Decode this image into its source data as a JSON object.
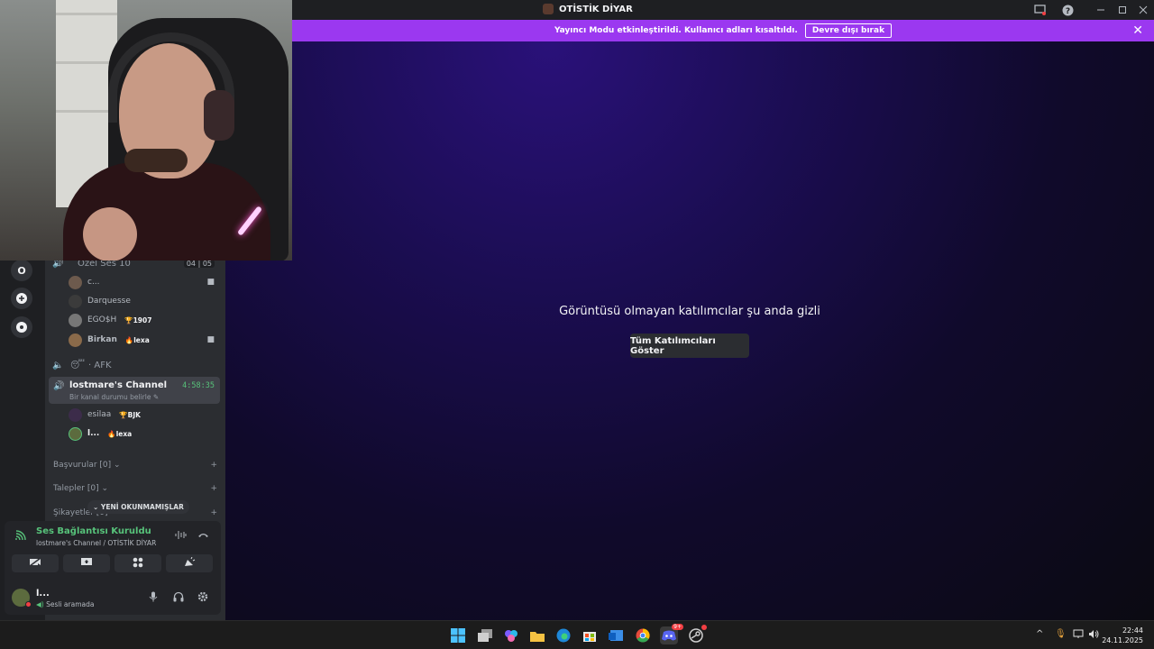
{
  "window": {
    "title": "OTİSTİK DİYAR"
  },
  "banner": {
    "message": "Yayıncı Modu etkinleştirildi. Kullanıcı adları kısaltıldı.",
    "disable_label": "Devre dışı bırak"
  },
  "stage": {
    "hidden_message": "Görüntüsü olmayan katılımcılar şu anda gizli",
    "show_all_label": "Tüm Katılımcıları Göster"
  },
  "rail": {
    "server_initial": "O"
  },
  "channels": {
    "private_channel": {
      "name": "Özel Ses 10",
      "count_a": "04",
      "count_b": "05",
      "users": [
        {
          "name": "c...",
          "badge": ""
        },
        {
          "name": "Darquesse",
          "badge": ""
        },
        {
          "name": "EGO$H",
          "badge": "1907"
        },
        {
          "name": "Birkan",
          "badge": "lexa"
        }
      ]
    },
    "afk": {
      "name": "AFK"
    },
    "active": {
      "name": "lostmare's Channel",
      "status": "Bir kanal durumu belirle",
      "timer": "4:58:35",
      "users": [
        {
          "name": "esilaa",
          "badge": "BJK"
        },
        {
          "name": "l...",
          "badge": "lexa"
        }
      ]
    },
    "categories": [
      {
        "name": "Başvurular [0]"
      },
      {
        "name": "Talepler [0]"
      },
      {
        "name": "Şikayetler [0]"
      }
    ],
    "unread_label": "YENİ OKUNMAMIŞLAR"
  },
  "voice": {
    "title": "Ses Bağlantısı Kuruldu",
    "subtitle": "lostmare's Channel / OTİSTİK DİYAR"
  },
  "user": {
    "name": "l...",
    "status": "Sesli aramada"
  },
  "taskbar": {
    "time": "22:44",
    "date": "24.11.2025",
    "discord_badge": "9+"
  },
  "colors": {
    "banner": "#9b38f0",
    "voice_green": "#57c27a",
    "sidebar": "#2b2d31"
  }
}
